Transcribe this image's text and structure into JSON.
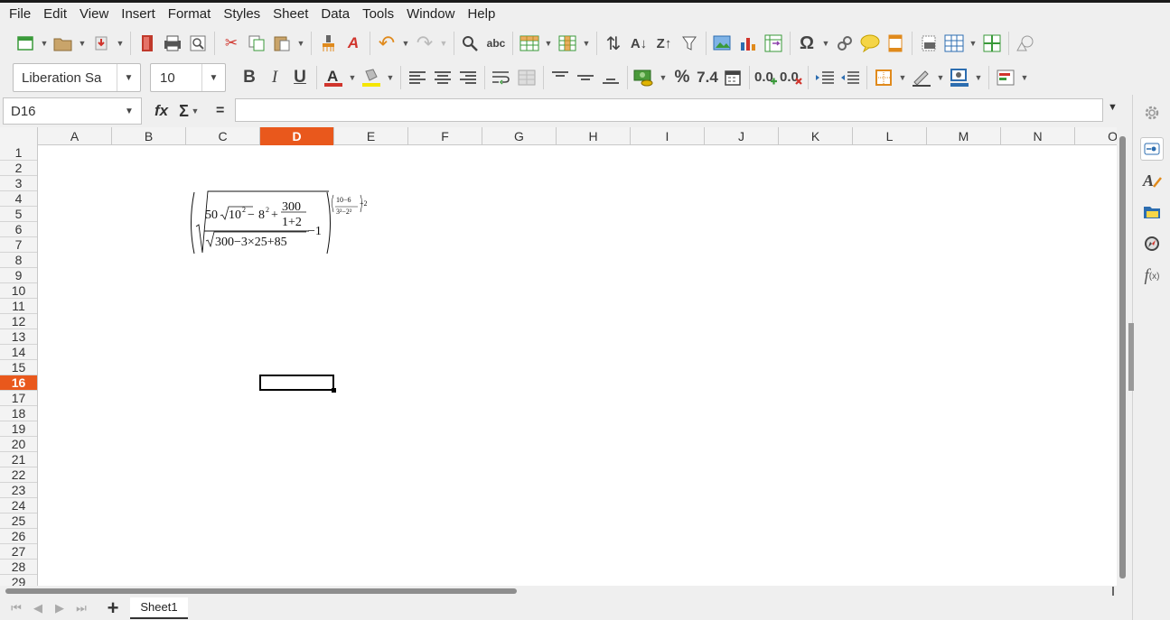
{
  "menu": [
    "File",
    "Edit",
    "View",
    "Insert",
    "Format",
    "Styles",
    "Sheet",
    "Data",
    "Tools",
    "Window",
    "Help"
  ],
  "font": {
    "name": "Liberation Sa",
    "size": "10"
  },
  "name_box": "D16",
  "formula_bar": {
    "fx": "fx",
    "sum": "Σ",
    "eq": "=",
    "value": ""
  },
  "columns": [
    "A",
    "B",
    "C",
    "D",
    "E",
    "F",
    "G",
    "H",
    "I",
    "J",
    "K",
    "L",
    "M",
    "N",
    "O"
  ],
  "selected_column": "D",
  "rows": [
    "1",
    "2",
    "3",
    "4",
    "5",
    "6",
    "7",
    "8",
    "9",
    "10",
    "11",
    "12",
    "13",
    "14",
    "15",
    "16",
    "17",
    "18",
    "19",
    "20",
    "21",
    "22",
    "23",
    "24",
    "25",
    "26",
    "27",
    "28",
    "29"
  ],
  "selected_row": "16",
  "formula": {
    "coef": "50",
    "radicand_base": "10",
    "exp2a": "2",
    "minus": "−",
    "radicand_b": "8",
    "exp2b": "2",
    "plus": "+",
    "frac_num": "300",
    "frac_den": "1+2",
    "den_radicand": "300−3×25+85",
    "minus_one": "−1",
    "pow_num": "10−6",
    "pow_den": "3²−2²",
    "pow_plus": "+2"
  },
  "sheet_tab": "Sheet1",
  "sidebar_icons": [
    "settings-icon",
    "properties-icon",
    "styles-icon",
    "gallery-icon",
    "navigator-icon",
    "functions-icon"
  ]
}
